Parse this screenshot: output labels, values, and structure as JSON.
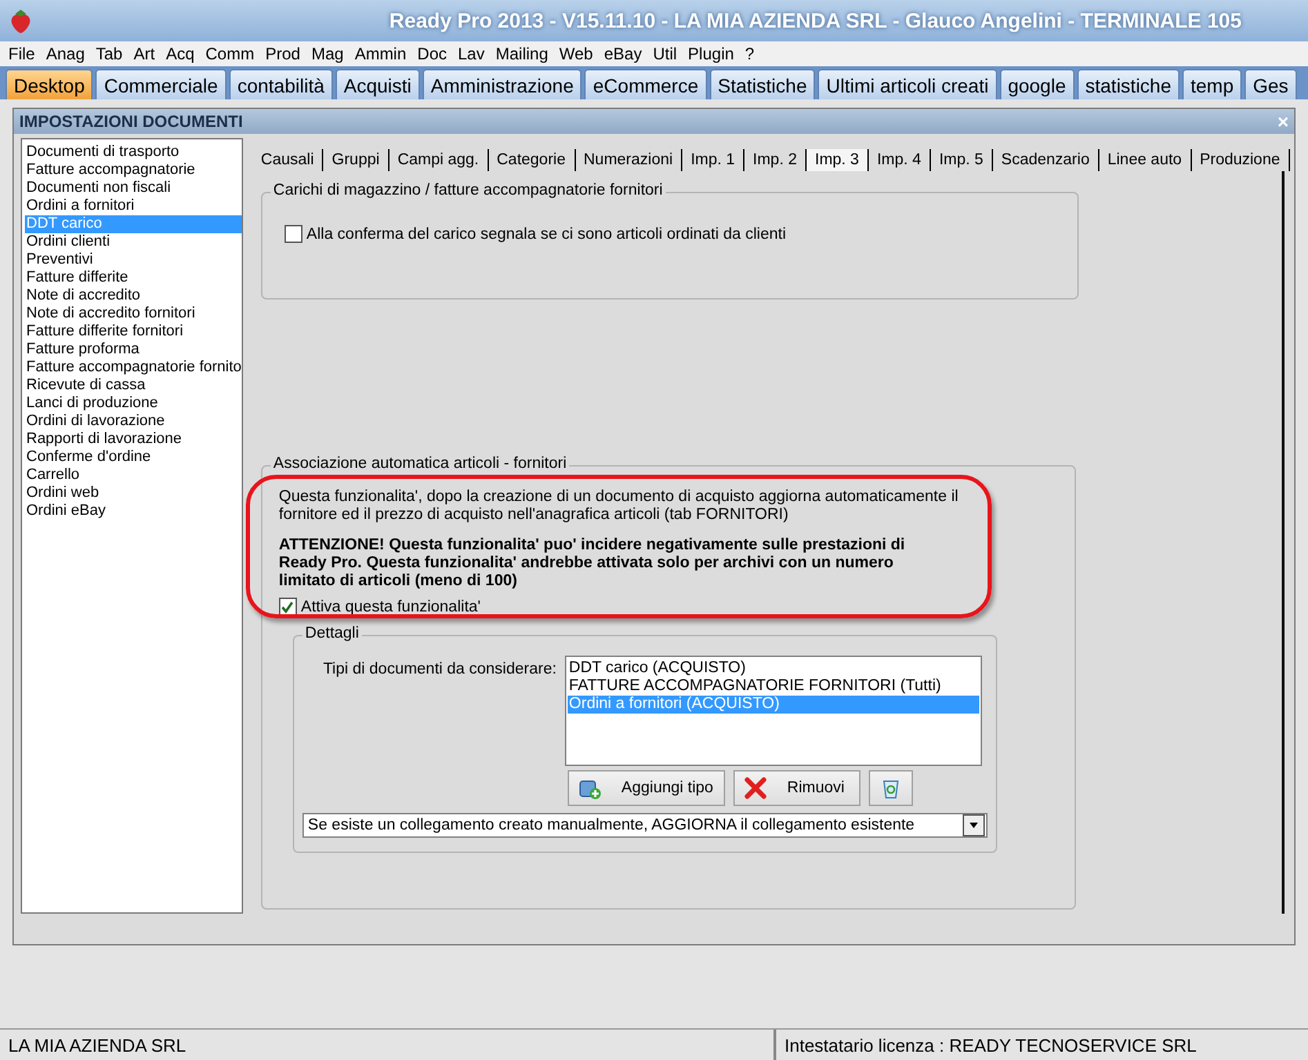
{
  "app_title": "Ready Pro 2013 - V15.11.10 - LA MIA AZIENDA SRL - Glauco Angelini - TERMINALE 105",
  "menu": [
    "File",
    "Anag",
    "Tab",
    "Art",
    "Acq",
    "Comm",
    "Prod",
    "Mag",
    "Ammin",
    "Doc",
    "Lav",
    "Mailing",
    "Web",
    "eBay",
    "Util",
    "Plugin",
    "?"
  ],
  "desktop_tabs": [
    {
      "label": "Desktop",
      "selected": true
    },
    {
      "label": "Commerciale",
      "selected": false
    },
    {
      "label": "contabilità",
      "selected": false
    },
    {
      "label": "Acquisti",
      "selected": false
    },
    {
      "label": "Amministrazione",
      "selected": false
    },
    {
      "label": "eCommerce",
      "selected": false
    },
    {
      "label": "Statistiche",
      "selected": false
    },
    {
      "label": "Ultimi articoli creati",
      "selected": false
    },
    {
      "label": "google",
      "selected": false
    },
    {
      "label": "statistiche",
      "selected": false
    },
    {
      "label": "temp",
      "selected": false
    },
    {
      "label": "Ges",
      "selected": false
    }
  ],
  "dialog": {
    "title": "IMPOSTAZIONI DOCUMENTI",
    "close": "×",
    "doc_types": [
      {
        "label": "Documenti di trasporto",
        "selected": false
      },
      {
        "label": "Fatture accompagnatorie",
        "selected": false
      },
      {
        "label": "Documenti non fiscali",
        "selected": false
      },
      {
        "label": "Ordini a fornitori",
        "selected": false
      },
      {
        "label": "DDT carico",
        "selected": true
      },
      {
        "label": "Ordini clienti",
        "selected": false
      },
      {
        "label": "Preventivi",
        "selected": false
      },
      {
        "label": "Fatture differite",
        "selected": false
      },
      {
        "label": "Note di accredito",
        "selected": false
      },
      {
        "label": "Note di accredito fornitori",
        "selected": false
      },
      {
        "label": "Fatture differite fornitori",
        "selected": false
      },
      {
        "label": "Fatture proforma",
        "selected": false
      },
      {
        "label": "Fatture accompagnatorie fornito",
        "selected": false
      },
      {
        "label": "Ricevute di cassa",
        "selected": false
      },
      {
        "label": "Lanci di produzione",
        "selected": false
      },
      {
        "label": "Ordini di lavorazione",
        "selected": false
      },
      {
        "label": "Rapporti di lavorazione",
        "selected": false
      },
      {
        "label": "Conferme d'ordine",
        "selected": false
      },
      {
        "label": "Carrello",
        "selected": false
      },
      {
        "label": "Ordini web",
        "selected": false
      },
      {
        "label": "Ordini eBay",
        "selected": false
      }
    ],
    "tabs": [
      {
        "label": "Causali",
        "selected": false
      },
      {
        "label": "Gruppi",
        "selected": false
      },
      {
        "label": "Campi agg.",
        "selected": false
      },
      {
        "label": "Categorie",
        "selected": false
      },
      {
        "label": "Numerazioni",
        "selected": false
      },
      {
        "label": "Imp. 1",
        "selected": false
      },
      {
        "label": "Imp. 2",
        "selected": false
      },
      {
        "label": "Imp. 3",
        "selected": true
      },
      {
        "label": "Imp. 4",
        "selected": false
      },
      {
        "label": "Imp. 5",
        "selected": false
      },
      {
        "label": "Scadenzario",
        "selected": false
      },
      {
        "label": "Linee auto",
        "selected": false
      },
      {
        "label": "Produzione",
        "selected": false
      }
    ],
    "group1": {
      "title": "Carichi di magazzino / fatture accompagnatorie fornitori",
      "checkbox": {
        "label": "Alla conferma del carico segnala se ci sono articoli ordinati da clienti",
        "checked": false
      }
    },
    "group2": {
      "title": "Associazione automatica articoli - fornitori",
      "description": "Questa funzionalita', dopo la creazione di un documento di acquisto aggiorna automaticamente il fornitore ed il prezzo di acquisto nell'anagrafica articoli (tab FORNITORI)",
      "warning": "ATTENZIONE! Questa funzionalita' puo' incidere negativamente sulle prestazioni di Ready Pro. Questa funzionalita' andrebbe attivata solo per archivi con un numero limitato di articoli (meno di 100)",
      "checkbox": {
        "label": "Attiva questa funzionalita'",
        "checked": true
      },
      "details": {
        "title": "Dettagli",
        "list_label": "Tipi di documenti da considerare:",
        "list": [
          {
            "label": "DDT carico (ACQUISTO)",
            "selected": false
          },
          {
            "label": "FATTURE ACCOMPAGNATORIE FORNITORI (Tutti)",
            "selected": false
          },
          {
            "label": "Ordini a fornitori (ACQUISTO)",
            "selected": true
          }
        ],
        "buttons": [
          {
            "kind": "add",
            "label": "Aggiungi tipo"
          },
          {
            "kind": "remove",
            "label": "Rimuovi"
          },
          {
            "kind": "clear"
          }
        ],
        "dropdown": {
          "value": "Se esiste un collegamento creato manualmente, AGGIORNA il collegamento esistente"
        }
      }
    }
  },
  "status_bar": {
    "company": "LA MIA AZIENDA SRL",
    "license": "Intestatario licenza : READY TECNOSERVICE SRL"
  }
}
